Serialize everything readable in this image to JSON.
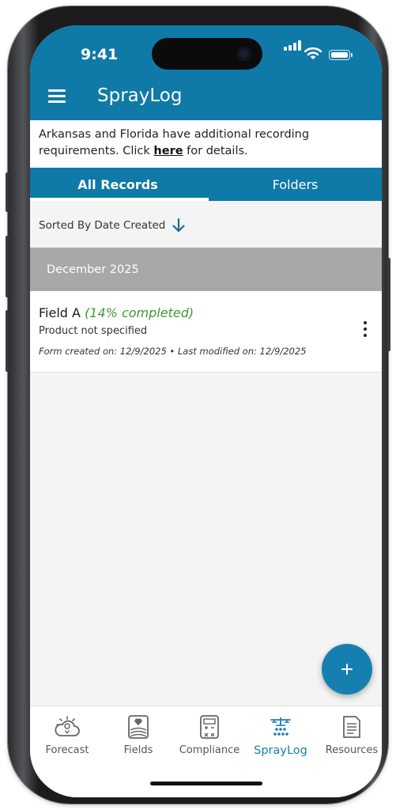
{
  "status": {
    "time": "9:41"
  },
  "appbar": {
    "title": "SprayLog"
  },
  "notice": {
    "text_before": "Arkansas and Florida have additional recording requirements. Click ",
    "link": "here",
    "text_after": " for details."
  },
  "tabs": [
    {
      "label": "All Records",
      "active": true
    },
    {
      "label": "Folders",
      "active": false
    }
  ],
  "sort": {
    "label": "Sorted By Date Created",
    "icon": "arrow-down-icon"
  },
  "groups": [
    {
      "month": "December 2025"
    }
  ],
  "records": [
    {
      "name": "Field A",
      "completion": "(14% completed)",
      "product": "Product not specified",
      "dates": "Form created on: 12/9/2025 • Last modified on: 12/9/2025"
    }
  ],
  "fab": {
    "icon": "plus-icon"
  },
  "bottom_nav": [
    {
      "label": "Forecast",
      "icon": "weather-icon",
      "active": false
    },
    {
      "label": "Fields",
      "icon": "field-icon",
      "active": false
    },
    {
      "label": "Compliance",
      "icon": "calculator-icon",
      "active": false
    },
    {
      "label": "SprayLog",
      "icon": "sprayer-icon",
      "active": true
    },
    {
      "label": "Resources",
      "icon": "document-icon",
      "active": false
    }
  ],
  "colors": {
    "primary": "#0f79a8",
    "accent": "#1580b0",
    "completion_green": "#3e9a34",
    "month_header": "#a8a8a8"
  }
}
